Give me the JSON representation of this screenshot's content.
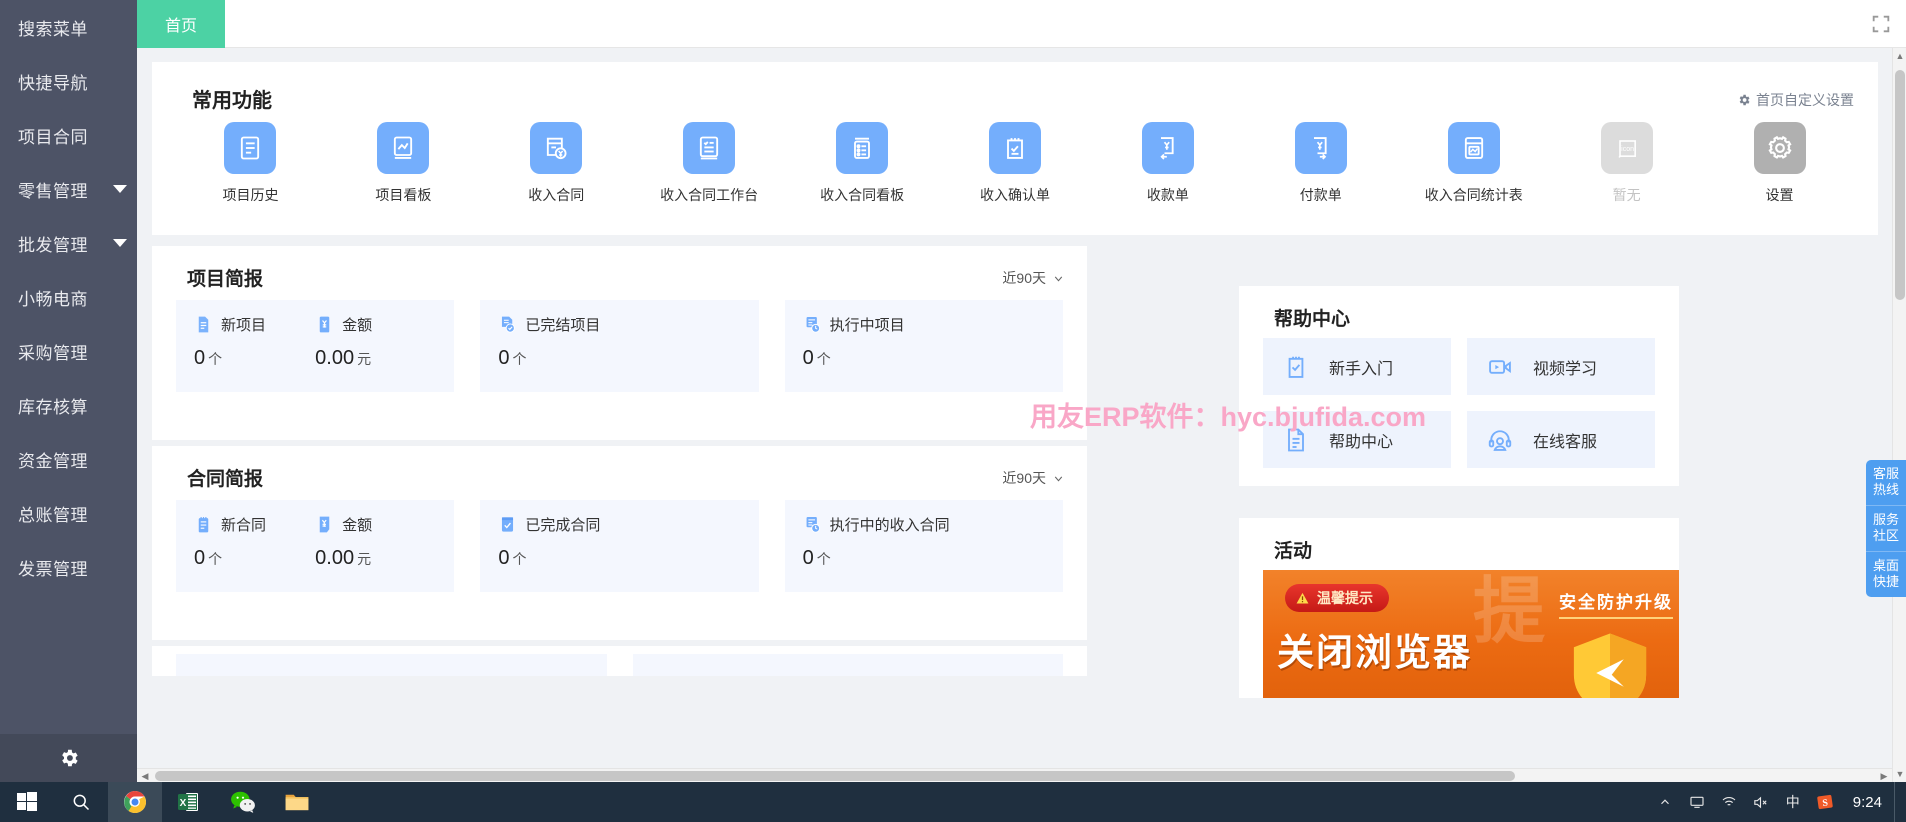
{
  "sidebar": {
    "items": [
      {
        "label": "搜索菜单",
        "caret": false
      },
      {
        "label": "快捷导航",
        "caret": false
      },
      {
        "label": "项目合同",
        "caret": false
      },
      {
        "label": "零售管理",
        "caret": true
      },
      {
        "label": "批发管理",
        "caret": true
      },
      {
        "label": "小畅电商",
        "caret": false
      },
      {
        "label": "采购管理",
        "caret": false
      },
      {
        "label": "库存核算",
        "caret": false
      },
      {
        "label": "资金管理",
        "caret": false
      },
      {
        "label": "总账管理",
        "caret": false
      },
      {
        "label": "发票管理",
        "caret": false
      }
    ],
    "settings_icon": "gear-icon"
  },
  "topbar": {
    "tabs": [
      {
        "label": "首页",
        "active": true
      }
    ],
    "expand_icon": "fullscreen-icon"
  },
  "quick_panel": {
    "title": "常用功能",
    "custom_setting": "首页自定义设置",
    "custom_setting_icon": "gear-icon",
    "functions": [
      {
        "label": "项目历史",
        "icon": "document-list-icon",
        "state": "normal"
      },
      {
        "label": "项目看板",
        "icon": "chart-book-icon",
        "state": "normal"
      },
      {
        "label": "收入合同",
        "icon": "receipt-yuan-icon",
        "state": "normal"
      },
      {
        "label": "收入合同工作台",
        "icon": "checklist-doc-icon",
        "state": "normal"
      },
      {
        "label": "收入合同看板",
        "icon": "list-lines-icon",
        "state": "normal"
      },
      {
        "label": "收入确认单",
        "icon": "clipboard-check-icon",
        "state": "normal"
      },
      {
        "label": "收款单",
        "icon": "yuan-in-icon",
        "state": "normal"
      },
      {
        "label": "付款单",
        "icon": "yuan-out-icon",
        "state": "normal"
      },
      {
        "label": "收入合同统计表",
        "icon": "report-chart-icon",
        "state": "normal"
      },
      {
        "label": "暂无",
        "icon": "placeholder-icon",
        "state": "empty"
      },
      {
        "label": "设置",
        "icon": "gear-icon",
        "state": "settings"
      }
    ]
  },
  "project_brief": {
    "title": "项目简报",
    "range": "近90天",
    "range_icon": "chevron-down-icon",
    "groups": [
      {
        "cells": [
          {
            "label": "新项目",
            "icon": "doc-blue-icon",
            "value": "0",
            "unit": "个"
          },
          {
            "label": "金额",
            "icon": "yuan-card-icon",
            "value": "0.00",
            "unit": "元"
          }
        ]
      },
      {
        "cells": [
          {
            "label": "已完结项目",
            "icon": "doc-check-icon",
            "value": "0",
            "unit": "个"
          }
        ]
      },
      {
        "cells": [
          {
            "label": "执行中项目",
            "icon": "doc-clock-icon",
            "value": "0",
            "unit": "个"
          }
        ]
      }
    ]
  },
  "contract_brief": {
    "title": "合同简报",
    "range": "近90天",
    "range_icon": "chevron-down-icon",
    "groups": [
      {
        "cells": [
          {
            "label": "新合同",
            "icon": "contract-icon",
            "value": "0",
            "unit": "个"
          },
          {
            "label": "金额",
            "icon": "yuan-card-icon",
            "value": "0.00",
            "unit": "元"
          }
        ]
      },
      {
        "cells": [
          {
            "label": "已完成合同",
            "icon": "check-box-icon",
            "value": "0",
            "unit": "个"
          }
        ]
      },
      {
        "cells": [
          {
            "label": "执行中的收入合同",
            "icon": "doc-clock-icon",
            "value": "0",
            "unit": "个"
          }
        ]
      }
    ]
  },
  "help_center": {
    "title": "帮助中心",
    "items": [
      {
        "label": "新手入门",
        "icon": "clipboard-check-icon"
      },
      {
        "label": "视频学习",
        "icon": "video-icon"
      },
      {
        "label": "帮助中心",
        "icon": "doc-lines-icon"
      },
      {
        "label": "在线客服",
        "icon": "headset-icon"
      }
    ]
  },
  "activity": {
    "title": "活动",
    "banner": {
      "tip_badge": "温馨提示",
      "tip_icon": "warning-icon",
      "headline_right": "安全防护升级",
      "headline_big": "关闭浏览器",
      "ghost_text": "提"
    }
  },
  "watermark": "用友ERP软件：hyc.bjufida.com",
  "float_buttons": [
    {
      "line1": "客服",
      "line2": "热线"
    },
    {
      "line1": "服务",
      "line2": "社区"
    },
    {
      "line1": "桌面",
      "line2": "快捷"
    }
  ],
  "taskbar": {
    "items": [
      {
        "name": "start-button",
        "icon": "windows-icon"
      },
      {
        "name": "search-button",
        "icon": "search-icon"
      },
      {
        "name": "chrome-button",
        "icon": "chrome-icon",
        "active": true
      },
      {
        "name": "excel-button",
        "icon": "excel-icon"
      },
      {
        "name": "wechat-button",
        "icon": "wechat-icon"
      },
      {
        "name": "explorer-button",
        "icon": "folder-icon"
      }
    ],
    "tray": [
      {
        "name": "tray-expand",
        "glyph": "︿"
      },
      {
        "name": "tray-monitor",
        "glyph": "▭"
      },
      {
        "name": "tray-network",
        "glyph": "◞"
      },
      {
        "name": "tray-volume-muted",
        "glyph": "🔇"
      },
      {
        "name": "tray-ime-chinese",
        "glyph": "中"
      },
      {
        "name": "tray-sogou",
        "glyph": "S"
      }
    ],
    "clock": "9:24"
  },
  "colors": {
    "sidebar_bg": "#4d5366",
    "tab_active": "#4cd2a4",
    "icon_blue": "#74aefc",
    "watermark_pink": "#f9a7c7",
    "banner_orange": "#ec6b12",
    "float_blue": "#4e9ef0"
  }
}
